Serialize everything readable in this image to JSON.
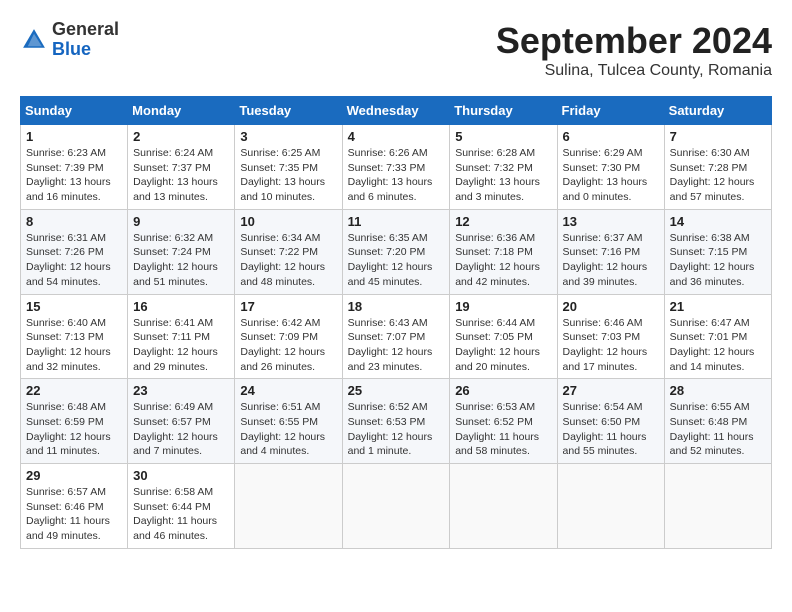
{
  "header": {
    "logo_general": "General",
    "logo_blue": "Blue",
    "month_title": "September 2024",
    "subtitle": "Sulina, Tulcea County, Romania"
  },
  "calendar": {
    "days_of_week": [
      "Sunday",
      "Monday",
      "Tuesday",
      "Wednesday",
      "Thursday",
      "Friday",
      "Saturday"
    ],
    "weeks": [
      [
        {
          "day": "1",
          "info": "Sunrise: 6:23 AM\nSunset: 7:39 PM\nDaylight: 13 hours and 16 minutes."
        },
        {
          "day": "2",
          "info": "Sunrise: 6:24 AM\nSunset: 7:37 PM\nDaylight: 13 hours and 13 minutes."
        },
        {
          "day": "3",
          "info": "Sunrise: 6:25 AM\nSunset: 7:35 PM\nDaylight: 13 hours and 10 minutes."
        },
        {
          "day": "4",
          "info": "Sunrise: 6:26 AM\nSunset: 7:33 PM\nDaylight: 13 hours and 6 minutes."
        },
        {
          "day": "5",
          "info": "Sunrise: 6:28 AM\nSunset: 7:32 PM\nDaylight: 13 hours and 3 minutes."
        },
        {
          "day": "6",
          "info": "Sunrise: 6:29 AM\nSunset: 7:30 PM\nDaylight: 13 hours and 0 minutes."
        },
        {
          "day": "7",
          "info": "Sunrise: 6:30 AM\nSunset: 7:28 PM\nDaylight: 12 hours and 57 minutes."
        }
      ],
      [
        {
          "day": "8",
          "info": "Sunrise: 6:31 AM\nSunset: 7:26 PM\nDaylight: 12 hours and 54 minutes."
        },
        {
          "day": "9",
          "info": "Sunrise: 6:32 AM\nSunset: 7:24 PM\nDaylight: 12 hours and 51 minutes."
        },
        {
          "day": "10",
          "info": "Sunrise: 6:34 AM\nSunset: 7:22 PM\nDaylight: 12 hours and 48 minutes."
        },
        {
          "day": "11",
          "info": "Sunrise: 6:35 AM\nSunset: 7:20 PM\nDaylight: 12 hours and 45 minutes."
        },
        {
          "day": "12",
          "info": "Sunrise: 6:36 AM\nSunset: 7:18 PM\nDaylight: 12 hours and 42 minutes."
        },
        {
          "day": "13",
          "info": "Sunrise: 6:37 AM\nSunset: 7:16 PM\nDaylight: 12 hours and 39 minutes."
        },
        {
          "day": "14",
          "info": "Sunrise: 6:38 AM\nSunset: 7:15 PM\nDaylight: 12 hours and 36 minutes."
        }
      ],
      [
        {
          "day": "15",
          "info": "Sunrise: 6:40 AM\nSunset: 7:13 PM\nDaylight: 12 hours and 32 minutes."
        },
        {
          "day": "16",
          "info": "Sunrise: 6:41 AM\nSunset: 7:11 PM\nDaylight: 12 hours and 29 minutes."
        },
        {
          "day": "17",
          "info": "Sunrise: 6:42 AM\nSunset: 7:09 PM\nDaylight: 12 hours and 26 minutes."
        },
        {
          "day": "18",
          "info": "Sunrise: 6:43 AM\nSunset: 7:07 PM\nDaylight: 12 hours and 23 minutes."
        },
        {
          "day": "19",
          "info": "Sunrise: 6:44 AM\nSunset: 7:05 PM\nDaylight: 12 hours and 20 minutes."
        },
        {
          "day": "20",
          "info": "Sunrise: 6:46 AM\nSunset: 7:03 PM\nDaylight: 12 hours and 17 minutes."
        },
        {
          "day": "21",
          "info": "Sunrise: 6:47 AM\nSunset: 7:01 PM\nDaylight: 12 hours and 14 minutes."
        }
      ],
      [
        {
          "day": "22",
          "info": "Sunrise: 6:48 AM\nSunset: 6:59 PM\nDaylight: 12 hours and 11 minutes."
        },
        {
          "day": "23",
          "info": "Sunrise: 6:49 AM\nSunset: 6:57 PM\nDaylight: 12 hours and 7 minutes."
        },
        {
          "day": "24",
          "info": "Sunrise: 6:51 AM\nSunset: 6:55 PM\nDaylight: 12 hours and 4 minutes."
        },
        {
          "day": "25",
          "info": "Sunrise: 6:52 AM\nSunset: 6:53 PM\nDaylight: 12 hours and 1 minute."
        },
        {
          "day": "26",
          "info": "Sunrise: 6:53 AM\nSunset: 6:52 PM\nDaylight: 11 hours and 58 minutes."
        },
        {
          "day": "27",
          "info": "Sunrise: 6:54 AM\nSunset: 6:50 PM\nDaylight: 11 hours and 55 minutes."
        },
        {
          "day": "28",
          "info": "Sunrise: 6:55 AM\nSunset: 6:48 PM\nDaylight: 11 hours and 52 minutes."
        }
      ],
      [
        {
          "day": "29",
          "info": "Sunrise: 6:57 AM\nSunset: 6:46 PM\nDaylight: 11 hours and 49 minutes."
        },
        {
          "day": "30",
          "info": "Sunrise: 6:58 AM\nSunset: 6:44 PM\nDaylight: 11 hours and 46 minutes."
        },
        null,
        null,
        null,
        null,
        null
      ]
    ]
  }
}
